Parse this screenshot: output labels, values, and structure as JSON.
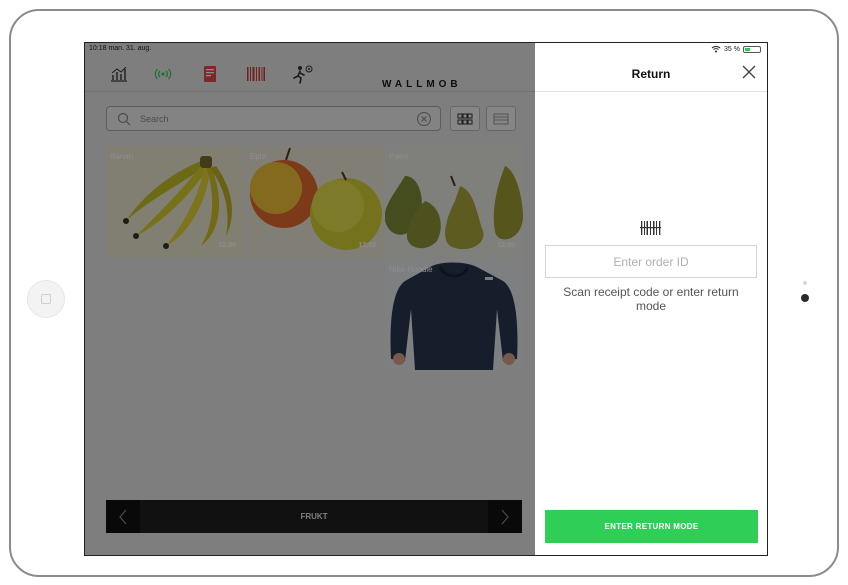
{
  "device": {
    "name": "iPad"
  },
  "status": {
    "time_date": "10:18  man. 31. aug.",
    "battery": "35 %",
    "battery_level": 0.35
  },
  "toolbar": {
    "icons": [
      "stats-icon",
      "wireless-icon",
      "receipt-icon",
      "barcode-icon",
      "user-settings-icon"
    ],
    "brand": "WALLMOB"
  },
  "search": {
    "placeholder": "Search"
  },
  "products": [
    {
      "name": "Banan",
      "price": "12,00"
    },
    {
      "name": "Eple",
      "price": "12,00"
    },
    {
      "name": "Pære",
      "price": "12,00"
    },
    {
      "name": "Nike Hoodie",
      "price": ""
    }
  ],
  "category_bar": {
    "label": "FRUKT"
  },
  "return_panel": {
    "title": "Return",
    "order_placeholder": "Enter order ID",
    "hint": "Scan receipt code or enter return mode",
    "button": "ENTER RETURN MODE"
  },
  "colors": {
    "accent_green": "#2fce57",
    "overlay": "rgba(0,0,0,0.45)"
  }
}
